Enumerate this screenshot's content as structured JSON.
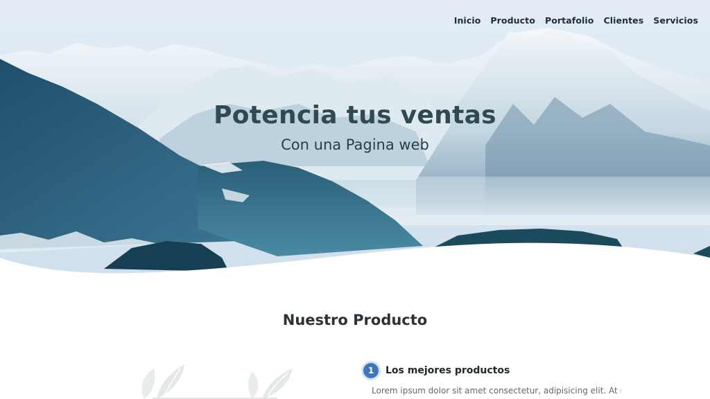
{
  "nav": {
    "items": [
      {
        "label": "Inicio"
      },
      {
        "label": "Producto"
      },
      {
        "label": "Portafolio"
      },
      {
        "label": "Clientes"
      },
      {
        "label": "Servicios"
      }
    ]
  },
  "hero": {
    "title": "Potencia tus ventas",
    "subtitle": "Con una Pagina web",
    "image_description": "snowy mountain landscape"
  },
  "product": {
    "section_title": "Nuestro Producto",
    "feature": {
      "number": "1",
      "title": "Los mejores productos",
      "text": "Lorem ipsum dolor sit amet consectetur, adipisicing elit. At non"
    }
  },
  "colors": {
    "accent": "#3f78b4",
    "heading": "#2f4b4f",
    "text": "#5f6b70"
  }
}
